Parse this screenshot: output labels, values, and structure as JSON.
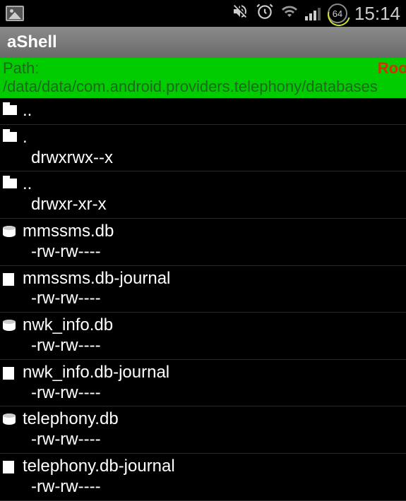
{
  "status_bar": {
    "battery_percent": "64",
    "time": "15:14"
  },
  "title_bar": {
    "app_name": "aShell"
  },
  "path_bar": {
    "path": "Path: /data/data/com.android.providers.telephony/databases",
    "root_label": "Root"
  },
  "files": [
    {
      "name": "..",
      "perms": "",
      "icon": "folder"
    },
    {
      "name": ".",
      "perms": "drwxrwx--x",
      "icon": "folder"
    },
    {
      "name": "..",
      "perms": "drwxr-xr-x",
      "icon": "folder"
    },
    {
      "name": "mmssms.db",
      "perms": "-rw-rw----",
      "icon": "db"
    },
    {
      "name": "mmssms.db-journal",
      "perms": "-rw-rw----",
      "icon": "file"
    },
    {
      "name": "nwk_info.db",
      "perms": "-rw-rw----",
      "icon": "db"
    },
    {
      "name": "nwk_info.db-journal",
      "perms": "-rw-rw----",
      "icon": "file"
    },
    {
      "name": "telephony.db",
      "perms": "-rw-rw----",
      "icon": "db"
    },
    {
      "name": "telephony.db-journal",
      "perms": "-rw-rw----",
      "icon": "file"
    }
  ]
}
